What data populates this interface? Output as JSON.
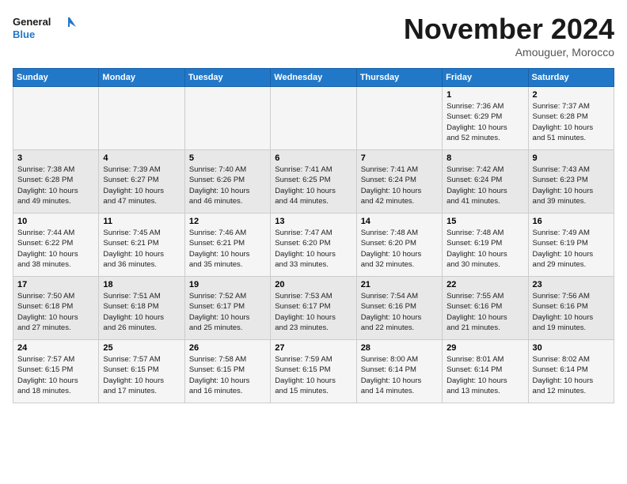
{
  "header": {
    "logo_line1": "General",
    "logo_line2": "Blue",
    "month": "November 2024",
    "location": "Amouguer, Morocco"
  },
  "weekdays": [
    "Sunday",
    "Monday",
    "Tuesday",
    "Wednesday",
    "Thursday",
    "Friday",
    "Saturday"
  ],
  "weeks": [
    [
      {
        "day": "",
        "info": ""
      },
      {
        "day": "",
        "info": ""
      },
      {
        "day": "",
        "info": ""
      },
      {
        "day": "",
        "info": ""
      },
      {
        "day": "",
        "info": ""
      },
      {
        "day": "1",
        "info": "Sunrise: 7:36 AM\nSunset: 6:29 PM\nDaylight: 10 hours\nand 52 minutes."
      },
      {
        "day": "2",
        "info": "Sunrise: 7:37 AM\nSunset: 6:28 PM\nDaylight: 10 hours\nand 51 minutes."
      }
    ],
    [
      {
        "day": "3",
        "info": "Sunrise: 7:38 AM\nSunset: 6:28 PM\nDaylight: 10 hours\nand 49 minutes."
      },
      {
        "day": "4",
        "info": "Sunrise: 7:39 AM\nSunset: 6:27 PM\nDaylight: 10 hours\nand 47 minutes."
      },
      {
        "day": "5",
        "info": "Sunrise: 7:40 AM\nSunset: 6:26 PM\nDaylight: 10 hours\nand 46 minutes."
      },
      {
        "day": "6",
        "info": "Sunrise: 7:41 AM\nSunset: 6:25 PM\nDaylight: 10 hours\nand 44 minutes."
      },
      {
        "day": "7",
        "info": "Sunrise: 7:41 AM\nSunset: 6:24 PM\nDaylight: 10 hours\nand 42 minutes."
      },
      {
        "day": "8",
        "info": "Sunrise: 7:42 AM\nSunset: 6:24 PM\nDaylight: 10 hours\nand 41 minutes."
      },
      {
        "day": "9",
        "info": "Sunrise: 7:43 AM\nSunset: 6:23 PM\nDaylight: 10 hours\nand 39 minutes."
      }
    ],
    [
      {
        "day": "10",
        "info": "Sunrise: 7:44 AM\nSunset: 6:22 PM\nDaylight: 10 hours\nand 38 minutes."
      },
      {
        "day": "11",
        "info": "Sunrise: 7:45 AM\nSunset: 6:21 PM\nDaylight: 10 hours\nand 36 minutes."
      },
      {
        "day": "12",
        "info": "Sunrise: 7:46 AM\nSunset: 6:21 PM\nDaylight: 10 hours\nand 35 minutes."
      },
      {
        "day": "13",
        "info": "Sunrise: 7:47 AM\nSunset: 6:20 PM\nDaylight: 10 hours\nand 33 minutes."
      },
      {
        "day": "14",
        "info": "Sunrise: 7:48 AM\nSunset: 6:20 PM\nDaylight: 10 hours\nand 32 minutes."
      },
      {
        "day": "15",
        "info": "Sunrise: 7:48 AM\nSunset: 6:19 PM\nDaylight: 10 hours\nand 30 minutes."
      },
      {
        "day": "16",
        "info": "Sunrise: 7:49 AM\nSunset: 6:19 PM\nDaylight: 10 hours\nand 29 minutes."
      }
    ],
    [
      {
        "day": "17",
        "info": "Sunrise: 7:50 AM\nSunset: 6:18 PM\nDaylight: 10 hours\nand 27 minutes."
      },
      {
        "day": "18",
        "info": "Sunrise: 7:51 AM\nSunset: 6:18 PM\nDaylight: 10 hours\nand 26 minutes."
      },
      {
        "day": "19",
        "info": "Sunrise: 7:52 AM\nSunset: 6:17 PM\nDaylight: 10 hours\nand 25 minutes."
      },
      {
        "day": "20",
        "info": "Sunrise: 7:53 AM\nSunset: 6:17 PM\nDaylight: 10 hours\nand 23 minutes."
      },
      {
        "day": "21",
        "info": "Sunrise: 7:54 AM\nSunset: 6:16 PM\nDaylight: 10 hours\nand 22 minutes."
      },
      {
        "day": "22",
        "info": "Sunrise: 7:55 AM\nSunset: 6:16 PM\nDaylight: 10 hours\nand 21 minutes."
      },
      {
        "day": "23",
        "info": "Sunrise: 7:56 AM\nSunset: 6:16 PM\nDaylight: 10 hours\nand 19 minutes."
      }
    ],
    [
      {
        "day": "24",
        "info": "Sunrise: 7:57 AM\nSunset: 6:15 PM\nDaylight: 10 hours\nand 18 minutes."
      },
      {
        "day": "25",
        "info": "Sunrise: 7:57 AM\nSunset: 6:15 PM\nDaylight: 10 hours\nand 17 minutes."
      },
      {
        "day": "26",
        "info": "Sunrise: 7:58 AM\nSunset: 6:15 PM\nDaylight: 10 hours\nand 16 minutes."
      },
      {
        "day": "27",
        "info": "Sunrise: 7:59 AM\nSunset: 6:15 PM\nDaylight: 10 hours\nand 15 minutes."
      },
      {
        "day": "28",
        "info": "Sunrise: 8:00 AM\nSunset: 6:14 PM\nDaylight: 10 hours\nand 14 minutes."
      },
      {
        "day": "29",
        "info": "Sunrise: 8:01 AM\nSunset: 6:14 PM\nDaylight: 10 hours\nand 13 minutes."
      },
      {
        "day": "30",
        "info": "Sunrise: 8:02 AM\nSunset: 6:14 PM\nDaylight: 10 hours\nand 12 minutes."
      }
    ]
  ]
}
